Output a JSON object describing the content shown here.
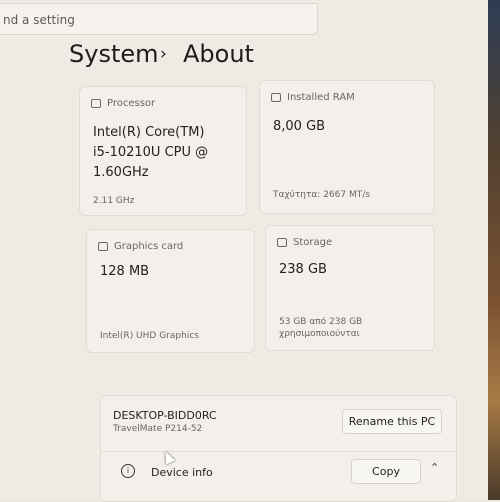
{
  "search": {
    "placeholder": "nd a setting"
  },
  "breadcrumb": {
    "parent": "System",
    "separator": "›",
    "current": "About"
  },
  "specs": {
    "processor": {
      "label": "Processor",
      "value_lines": [
        "Intel(R) Core(TM)",
        "i5-10210U CPU @",
        "1.60GHz"
      ],
      "sub": "2.11 GHz"
    },
    "ram": {
      "label": "Installed RAM",
      "value": "8,00 GB",
      "sub": "Ταχύτητα: 2667 MT/s"
    },
    "graphics": {
      "label": "Graphics card",
      "value": "128 MB",
      "sub": "Intel(R) UHD Graphics"
    },
    "storage": {
      "label": "Storage",
      "value": "238 GB",
      "sub_lines": [
        "53 GB από 238 GB",
        "χρησιμοποιούνται"
      ]
    }
  },
  "device": {
    "name": "DESKTOP-BIDD0RC",
    "model": "TravelMate P214-52",
    "rename_label": "Rename this PC",
    "info_label": "Device info",
    "copy_label": "Copy"
  }
}
